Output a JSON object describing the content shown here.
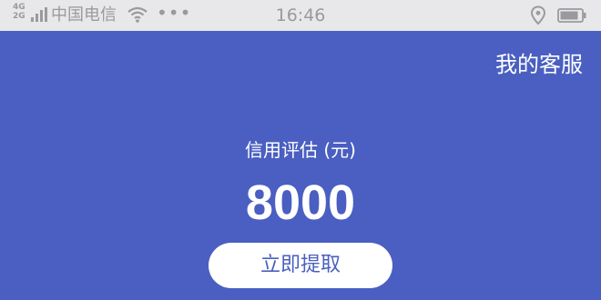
{
  "status_bar": {
    "network_type_top": "4G",
    "network_type_bottom": "2G",
    "carrier": "中国电信",
    "more_dots": "•••",
    "time": "16:46",
    "icons": [
      "signal-icon",
      "wifi-icon",
      "location-icon",
      "battery-icon"
    ]
  },
  "header": {
    "service_link": "我的客服"
  },
  "main": {
    "credit_label": "信用评估 (元)",
    "credit_amount": "8000",
    "withdraw_button": "立即提取"
  },
  "colors": {
    "background": "#4a5fc1",
    "status_bar": "#e8e8ea",
    "button_bg": "#ffffff",
    "button_text": "#4a5fc1"
  }
}
